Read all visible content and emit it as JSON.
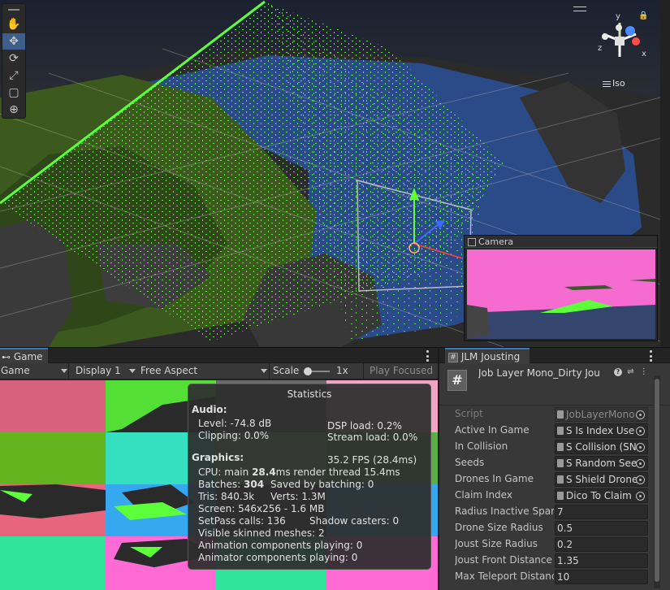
{
  "scene": {
    "view_mode": "Iso",
    "gizmo_axes": {
      "y": "y",
      "x": "x",
      "z": "z"
    },
    "tools": [
      "hand-icon",
      "move-icon",
      "rotate-icon",
      "scale-icon",
      "rect-icon",
      "transform-icon"
    ],
    "active_tool_index": 1,
    "camera_preview_title": "Camera"
  },
  "game": {
    "tab_label": "Game",
    "display_mode": "Game",
    "display": "Display 1",
    "aspect": "Free Aspect",
    "scale_label": "Scale",
    "scale_value": "1x",
    "play_mode": "Play Focused"
  },
  "statistics": {
    "title": "Statistics",
    "audio_header": "Audio:",
    "level": "Level: -74.8 dB",
    "clipping": "Clipping: 0.0%",
    "dsp_load": "DSP load: 0.2%",
    "stream_load": "Stream load: 0.0%",
    "graphics_header": "Graphics:",
    "fps": "35.2 FPS (28.4ms)",
    "cpu_prefix": "CPU: main ",
    "cpu_main": "28.4",
    "cpu_suffix": "ms  render thread 15.4ms",
    "batches_prefix": "Batches: ",
    "batches": "304",
    "saved_by_batching": "Saved by batching: 0",
    "tris": "Tris: 840.3k",
    "verts": "Verts: 1.3M",
    "screen": "Screen: 546x256 - 1.6 MB",
    "setpass": "SetPass calls: 136",
    "shadow_casters": "Shadow casters: 0",
    "skinned_meshes": "Visible skinned meshes: 2",
    "animation_components": "Animation components playing: 0",
    "animator_components": "Animator components playing: 0"
  },
  "inspector": {
    "tab_label": "JLM Jousting",
    "component_title": "Job Layer Mono_Dirty Jou",
    "properties": [
      {
        "label": "Script",
        "value": "JobLayerMono",
        "kind": "script"
      },
      {
        "label": "Active In Game",
        "value": "S Is Index Use",
        "kind": "object"
      },
      {
        "label": "In Collision",
        "value": "S Collision (SN",
        "kind": "object"
      },
      {
        "label": "Seeds",
        "value": "S Random See",
        "kind": "object"
      },
      {
        "label": "Drones In Game",
        "value": "S Shield Drone",
        "kind": "object"
      },
      {
        "label": "Claim Index",
        "value": "Dico To Claim",
        "kind": "object"
      },
      {
        "label": "Radius Inactive Span",
        "value": "7",
        "kind": "number"
      },
      {
        "label": "Drone Size Radius",
        "value": "0.5",
        "kind": "number"
      },
      {
        "label": "Joust Size Radius",
        "value": "0.2",
        "kind": "number"
      },
      {
        "label": "Joust Front Distance",
        "value": "1.35",
        "kind": "number"
      },
      {
        "label": "Max Teleport Distance",
        "value": "10",
        "kind": "number"
      }
    ]
  },
  "colors": {
    "accent": "#3a79bb",
    "scene_green_points": "#5cff3a",
    "water": "#2b4a88",
    "camera_pink": "#f56bd0"
  }
}
